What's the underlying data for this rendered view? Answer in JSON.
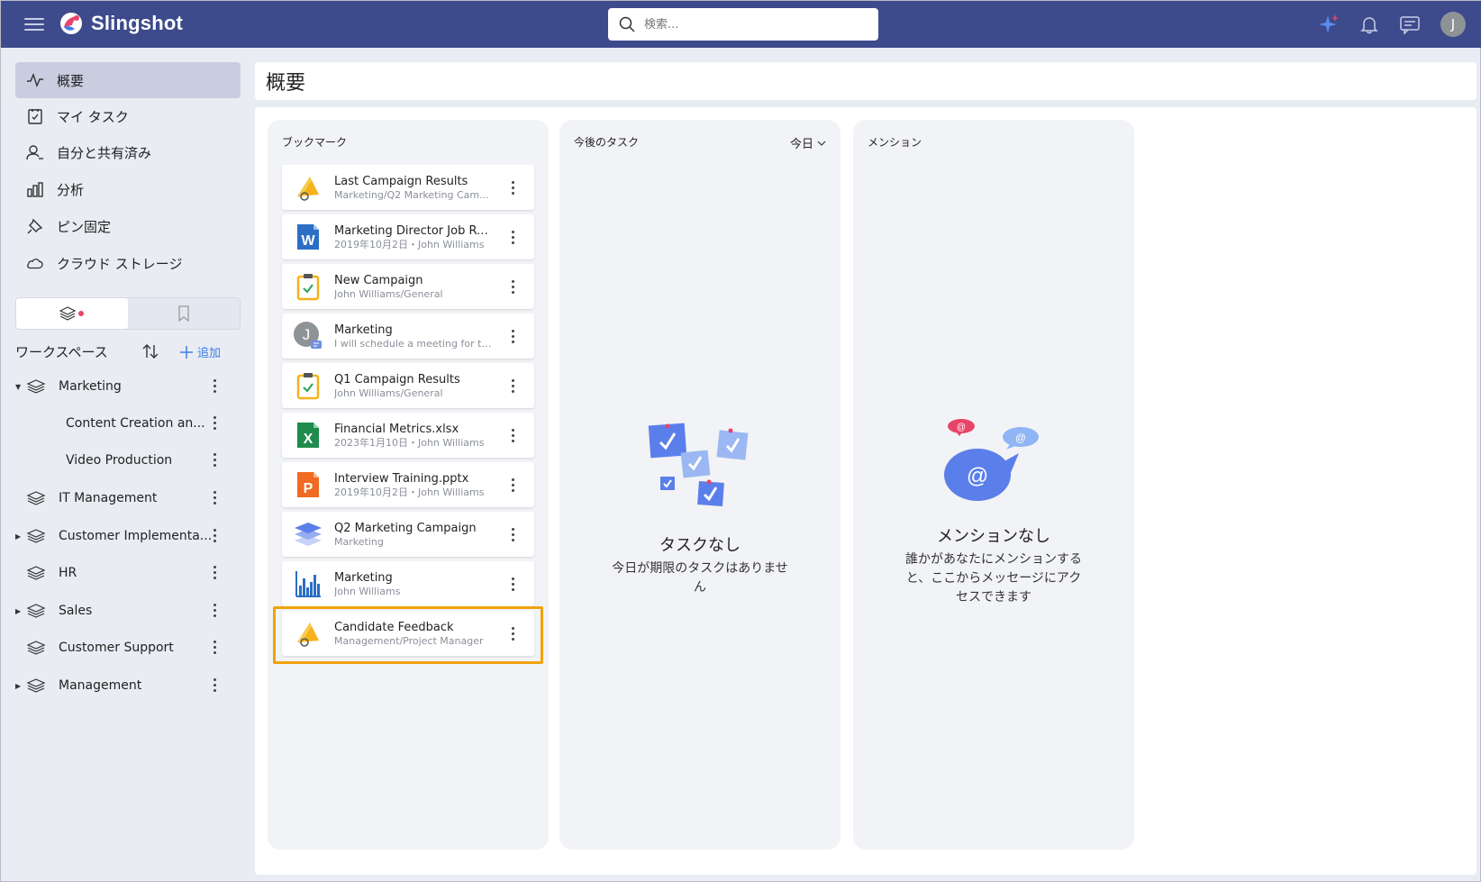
{
  "app": {
    "name": "Slingshot"
  },
  "colors": {
    "topbar": "#3d4a8c",
    "accent": "#3e7ce8",
    "highlight": "#f0a30a"
  },
  "search": {
    "placeholder": "検索...",
    "icon": "search-icon"
  },
  "topbar_icons": [
    "ai-sparkle-icon",
    "bell-icon",
    "chat-icon"
  ],
  "user": {
    "initial": "J"
  },
  "sidebar": {
    "nav": [
      {
        "label": "概要",
        "icon": "activity-icon",
        "active": true
      },
      {
        "label": "マイ タスク",
        "icon": "task-checkbox-icon"
      },
      {
        "label": "自分と共有済み",
        "icon": "shared-user-icon"
      },
      {
        "label": "分析",
        "icon": "bar-chart-icon"
      },
      {
        "label": "ピン固定",
        "icon": "pin-icon"
      },
      {
        "label": "クラウド ストレージ",
        "icon": "cloud-icon"
      }
    ],
    "workspace_header": {
      "title": "ワークスペース",
      "add_label": "追加"
    },
    "workspaces": [
      {
        "name": "Marketing",
        "expanded": true
      },
      {
        "name": "Content Creation an...",
        "child": true
      },
      {
        "name": "Video Production",
        "child": true
      },
      {
        "name": "IT Management"
      },
      {
        "name": "Customer Implementa...",
        "collapsed": true
      },
      {
        "name": "HR"
      },
      {
        "name": "Sales",
        "collapsed": true
      },
      {
        "name": "Customer Support"
      },
      {
        "name": "Management",
        "collapsed": true
      }
    ]
  },
  "main": {
    "title": "概要",
    "bookmarks": {
      "title": "ブックマーク",
      "items": [
        {
          "title": "Last Campaign Results",
          "subtitle": "Marketing/Q2 Marketing Cam...",
          "icon": "megaphone-icon"
        },
        {
          "title": "Marketing Director Job Ro...",
          "subtitle": "2019年10月2日・John Williams",
          "icon": "word-file-icon"
        },
        {
          "title": "New Campaign",
          "subtitle": "John Williams/General",
          "icon": "clipboard-check-icon"
        },
        {
          "title": "Marketing",
          "subtitle": "I will schedule a meeting for to...",
          "icon": "user-message-icon"
        },
        {
          "title": "Q1 Campaign Results",
          "subtitle": "John Williams/General",
          "icon": "clipboard-check-icon"
        },
        {
          "title": "Financial Metrics.xlsx",
          "subtitle": "2023年1月10日・John Williams",
          "icon": "excel-file-icon"
        },
        {
          "title": "Interview Training.pptx",
          "subtitle": "2019年10月2日・John Williams",
          "icon": "powerpoint-file-icon"
        },
        {
          "title": "Q2 Marketing Campaign",
          "subtitle": "Marketing",
          "icon": "layers-icon"
        },
        {
          "title": "Marketing",
          "subtitle": "John Williams",
          "icon": "dashboard-chart-icon"
        },
        {
          "title": "Candidate Feedback",
          "subtitle": "Management/Project Manager",
          "icon": "megaphone-icon",
          "highlighted": true
        }
      ]
    },
    "tasks": {
      "title": "今後のタスク",
      "filter": "今日",
      "empty_title": "タスクなし",
      "empty_text": "今日が期限のタスクはありません"
    },
    "mentions": {
      "title": "メンション",
      "empty_title": "メンションなし",
      "empty_text": "誰かがあなたにメンションすると、ここからメッセージにアクセスできます"
    }
  }
}
